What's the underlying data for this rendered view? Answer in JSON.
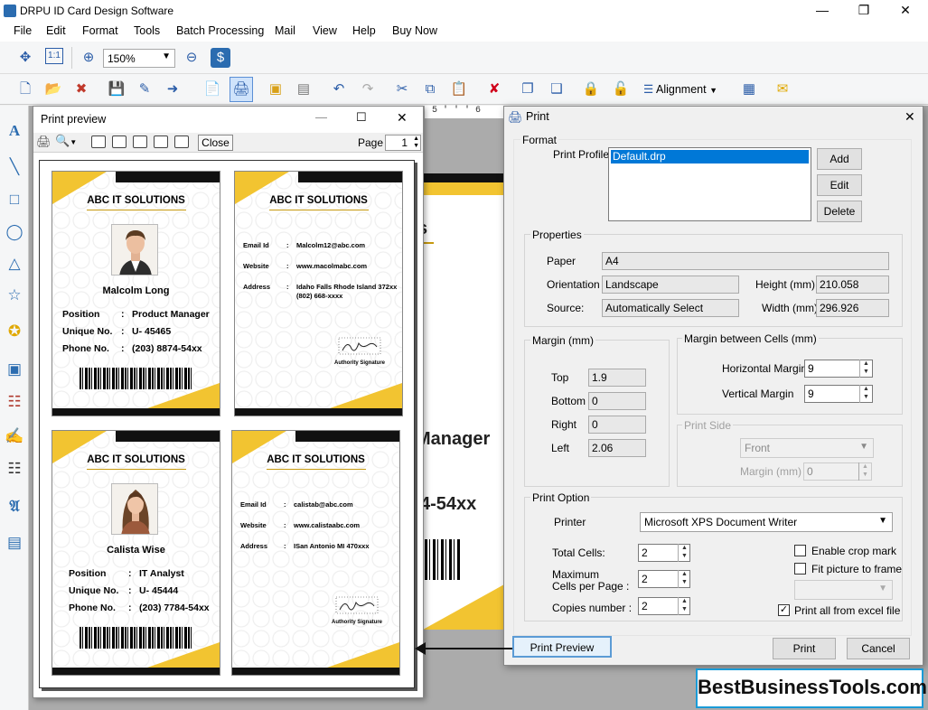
{
  "app": {
    "title": "DRPU ID Card Design Software"
  },
  "menu": [
    "File",
    "Edit",
    "Format",
    "Tools",
    "Batch Processing",
    "Mail",
    "View",
    "Help",
    "Buy Now"
  ],
  "toolbar": {
    "zoom": "150%",
    "alignment_label": "Alignment"
  },
  "ruler": "5 ' ' ' 6",
  "canvas": {
    "partial_text_1": "s",
    "partial_text_2": "Manager",
    "partial_text_3": "4-54xx"
  },
  "preview": {
    "title": "Print preview",
    "close_label": "Close",
    "page_label": "Page",
    "page_value": "1",
    "cards": [
      {
        "company": "ABC IT SOLUTIONS",
        "name": "Malcolm Long",
        "fields": [
          {
            "label": "Position",
            "value": "Product Manager"
          },
          {
            "label": "Unique No.",
            "value": "U- 45465"
          },
          {
            "label": "Phone No.",
            "value": "(203) 8874-54xx"
          }
        ]
      },
      {
        "company": "ABC IT SOLUTIONS",
        "back": [
          {
            "label": "Email Id",
            "value": "Malcolm12@abc.com"
          },
          {
            "label": "Website",
            "value": "www.macolmabc.com"
          },
          {
            "label": "Address",
            "value": "Idaho Falls Rhode Island 372xx",
            "value2": "(802) 668-xxxx"
          }
        ],
        "signature": "Authority Signature"
      },
      {
        "company": "ABC IT SOLUTIONS",
        "name": "Calista Wise",
        "fields": [
          {
            "label": "Position",
            "value": "IT Analyst"
          },
          {
            "label": "Unique No.",
            "value": "U- 45444"
          },
          {
            "label": "Phone No.",
            "value": "(203) 7784-54xx"
          }
        ]
      },
      {
        "company": "ABC IT SOLUTIONS",
        "back": [
          {
            "label": "Email Id",
            "value": "calistab@abc.com"
          },
          {
            "label": "Website",
            "value": "www.calistaabc.com"
          },
          {
            "label": "Address",
            "value": "ISan Antonio MI 470xxx"
          }
        ],
        "signature": "Authority Signature"
      }
    ]
  },
  "print": {
    "title": "Print",
    "format": {
      "group": "Format",
      "profile_label": "Print Profile",
      "profile_selected": "Default.drp",
      "add": "Add",
      "edit": "Edit",
      "delete": "Delete"
    },
    "properties": {
      "group": "Properties",
      "paper_label": "Paper",
      "paper": "A4",
      "orientation_label": "Orientation",
      "orientation": "Landscape",
      "source_label": "Source:",
      "source": "Automatically Select",
      "height_label": "Height (mm)",
      "height": "210.058",
      "width_label": "Width (mm)",
      "width": "296.926"
    },
    "margin": {
      "group": "Margin (mm)",
      "top_label": "Top",
      "top": "1.9",
      "bottom_label": "Bottom",
      "bottom": "0",
      "right_label": "Right",
      "right": "0",
      "left_label": "Left",
      "left": "2.06"
    },
    "cells": {
      "group": "Margin between Cells (mm)",
      "h_label": "Horizontal Margin",
      "h": "9",
      "v_label": "Vertical Margin",
      "v": "9"
    },
    "side": {
      "group": "Print Side",
      "side_value": "Front",
      "margin_label": "Margin (mm)",
      "margin_value": "0"
    },
    "option": {
      "group": "Print Option",
      "printer_label": "Printer",
      "printer": "Microsoft XPS Document Writer",
      "total_label": "Total Cells:",
      "total": "2",
      "max_label_1": "Maximum",
      "max_label_2": "Cells per Page :",
      "max": "2",
      "copies_label": "Copies number :",
      "copies": "2",
      "crop_label": "Enable crop mark",
      "fit_label": "Fit picture to frame",
      "excel_label": "Print all from excel file"
    },
    "preview_btn": "Print Preview",
    "print_btn": "Print",
    "cancel_btn": "Cancel"
  },
  "watermark": "BestBusinessTools.com"
}
